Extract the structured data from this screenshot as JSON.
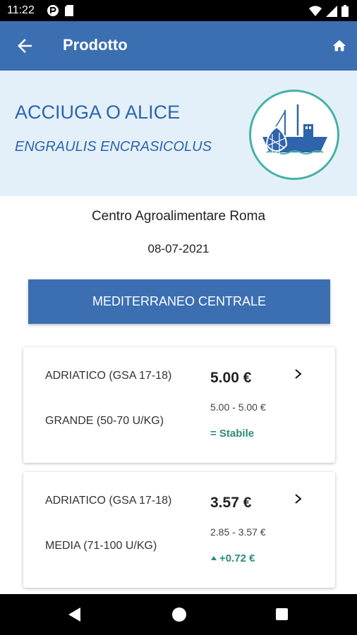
{
  "status_bar": {
    "time": "11:22"
  },
  "app_bar": {
    "title": "Prodotto"
  },
  "product": {
    "name": "ACCIUGA O ALICE",
    "latin_name": "ENGRAULIS ENCRASICOLUS"
  },
  "market": "Centro Agroalimentare Roma",
  "date": "08-07-2021",
  "region_button": "MEDITERRANEO CENTRALE",
  "colors": {
    "primary": "#3b6fb2",
    "hero_bg": "#e3f0fa",
    "accent_teal": "#45b2a4",
    "trend_green": "#2e8a7c"
  },
  "cards": [
    {
      "area": "ADRIATICO (GSA 17-18)",
      "size": "GRANDE (50-70 U/KG)",
      "price": "5.00 €",
      "range": "5.00 - 5.00 €",
      "trend": "= Stabile"
    },
    {
      "area": "ADRIATICO (GSA 17-18)",
      "size": "MEDIA (71-100 U/KG)",
      "price": "3.57 €",
      "range": "2.85 - 3.57 €",
      "trend": "+0.72 €"
    }
  ],
  "icons": {
    "back": "arrow-left-icon",
    "home": "home-icon",
    "logo": "fishing-boat-icon",
    "chevron": "chevron-right-icon",
    "trend_up": "caret-up-icon"
  }
}
